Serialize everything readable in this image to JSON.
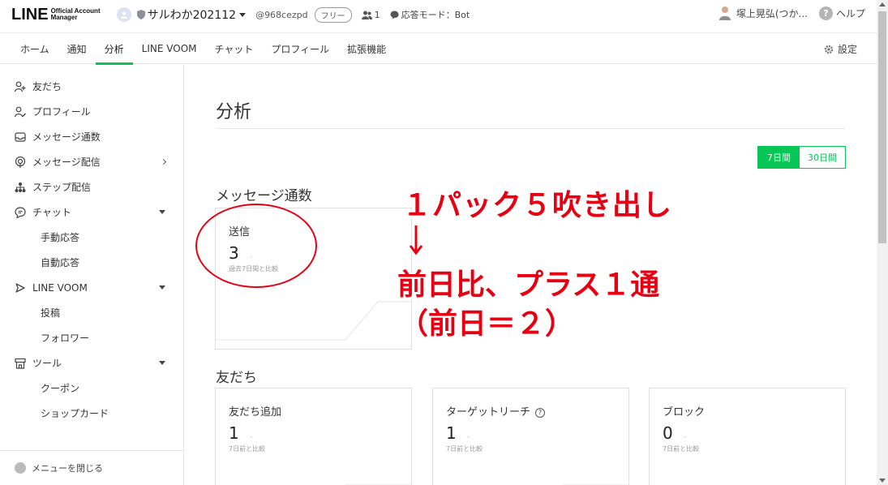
{
  "header": {
    "logo_main": "LINE",
    "logo_sub_1": "Official Account",
    "logo_sub_2": "Manager",
    "account_name": "サルわか202112",
    "account_id": "@968cezpd",
    "plan_badge": "フリー",
    "friends_count": "1",
    "response_mode": "応答モード：Bot",
    "user_name": "塚上晃弘(つか...",
    "help_label": "ヘルプ"
  },
  "tabs": [
    {
      "label": "ホーム"
    },
    {
      "label": "通知"
    },
    {
      "label": "分析",
      "active": true
    },
    {
      "label": "LINE VOOM"
    },
    {
      "label": "チャット"
    },
    {
      "label": "プロフィール"
    },
    {
      "label": "拡張機能"
    }
  ],
  "settings_label": "設定",
  "sidebar": {
    "items": [
      {
        "label": "友だち",
        "icon": "add-friend-icon"
      },
      {
        "label": "プロフィール",
        "icon": "profile-icon"
      },
      {
        "label": "メッセージ通数",
        "icon": "inbox-icon"
      },
      {
        "label": "メッセージ配信",
        "icon": "broadcast-icon"
      },
      {
        "label": "ステップ配信",
        "icon": "step-icon"
      },
      {
        "label": "チャット",
        "icon": "chat-icon"
      },
      {
        "label": "手動応答"
      },
      {
        "label": "自動応答"
      },
      {
        "label": "LINE VOOM",
        "icon": "voom-icon"
      },
      {
        "label": "投稿"
      },
      {
        "label": "フォロワー"
      },
      {
        "label": "ツール",
        "icon": "tool-icon"
      },
      {
        "label": "クーポン"
      },
      {
        "label": "ショップカード"
      }
    ],
    "close_menu": "メニューを閉じる"
  },
  "main": {
    "title": "分析",
    "period": {
      "on": "7日間",
      "off": "30日間"
    },
    "messages_section": "メッセージ通数",
    "sent_card": {
      "label": "送信",
      "value": "3",
      "dash": "-",
      "compare": "過去7日間と比較"
    },
    "friends_section": "友だち",
    "friend_cards": [
      {
        "label": "友だち追加",
        "value": "1",
        "dash": "-",
        "compare": "7日前と比較"
      },
      {
        "label": "ターゲットリーチ",
        "value": "1",
        "dash": "-",
        "compare": "7日前と比較"
      },
      {
        "label": "ブロック",
        "value": "0",
        "dash": "-",
        "compare": "7日前と比較"
      }
    ]
  },
  "annotation": {
    "line1": "１パック５吹き出し",
    "line2": "前日比、プラス１通",
    "line3": "（前日＝２）",
    "color": "#e60012"
  },
  "colors": {
    "accent": "#06c755"
  }
}
